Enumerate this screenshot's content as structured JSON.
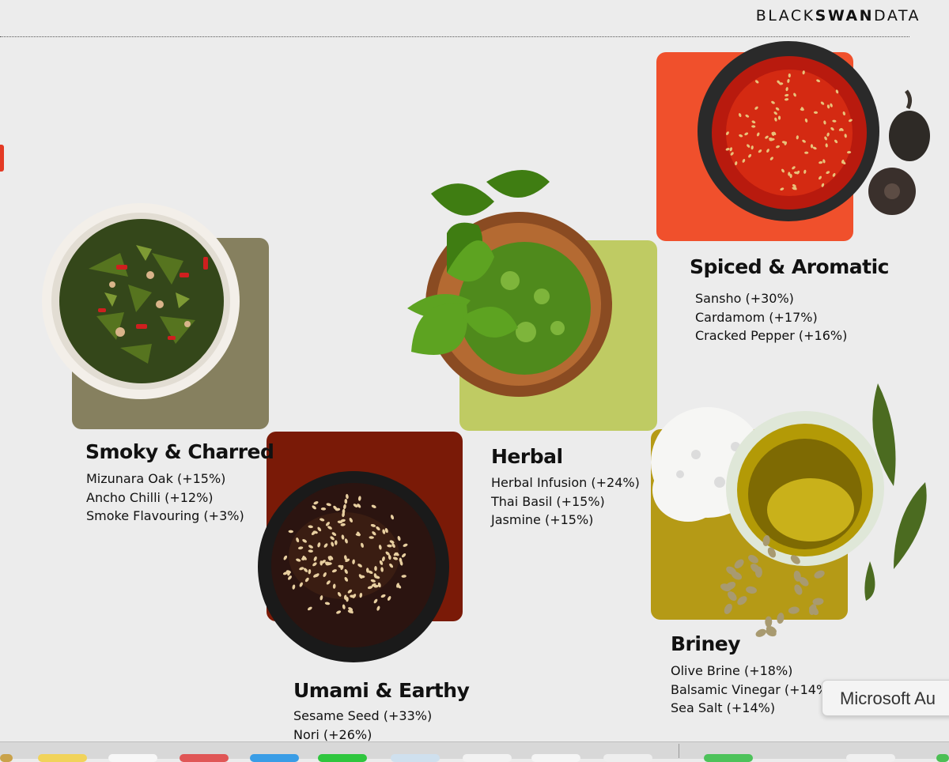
{
  "brand": {
    "light1": "BLACK",
    "bold": "SWAN",
    "light2": "DATA"
  },
  "categories": {
    "smoky": {
      "title": "Smoky & Charred",
      "color": "#86805f",
      "items": [
        "Mizunara Oak (+15%)",
        "Ancho Chilli (+12%)",
        "Smoke Flavouring (+3%)"
      ]
    },
    "umami": {
      "title": "Umami & Earthy",
      "color": "#7a1a07",
      "items": [
        "Sesame Seed (+33%)",
        "Nori (+26%)"
      ]
    },
    "herbal": {
      "title": "Herbal",
      "color": "#bfcb63",
      "items": [
        "Herbal Infusion (+24%)",
        "Thai Basil (+15%)",
        "Jasmine (+15%)"
      ]
    },
    "spiced": {
      "title": "Spiced & Aromatic",
      "color": "#f0502c",
      "items": [
        "Sansho (+30%)",
        "Cardamom (+17%)",
        "Cracked Pepper (+16%)"
      ]
    },
    "briney": {
      "title": "Briney",
      "color": "#b59a16",
      "items": [
        "Olive Brine (+18%)",
        "Balsamic Vinegar (+14%)",
        "Sea Salt (+14%)"
      ]
    }
  },
  "tooltip": {
    "text": "Microsoft Au"
  },
  "dock": {
    "icons": [
      "finder-icon",
      "notes-icon",
      "mail-icon",
      "app-red-icon",
      "safari-icon",
      "messages-icon",
      "app-icon",
      "app-icon",
      "app-icon",
      "app-icon",
      "facetime-icon",
      "app-icon"
    ]
  }
}
